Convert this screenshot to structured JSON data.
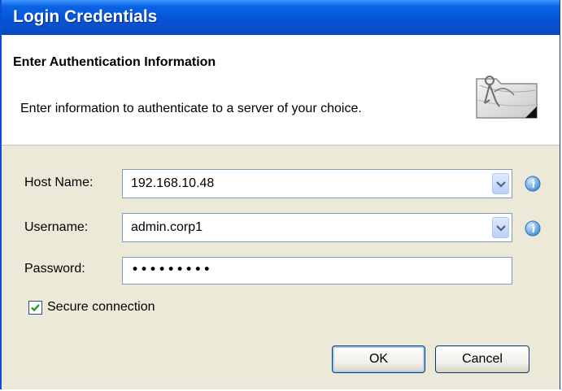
{
  "window": {
    "title": "Login Credentials"
  },
  "banner": {
    "heading": "Enter Authentication Information",
    "description": "Enter information to authenticate to a server of your choice.",
    "icon": "credentials-wizard-icon"
  },
  "form": {
    "host": {
      "label": "Host Name:",
      "value": "192.168.10.48",
      "icon": "info-icon"
    },
    "username": {
      "label": "Username:",
      "value": "admin.corp1",
      "icon": "info-icon"
    },
    "password": {
      "label": "Password:",
      "masked_value": "•••••••••"
    },
    "secure": {
      "label": "Secure connection",
      "checked": true
    }
  },
  "buttons": {
    "ok": "OK",
    "cancel": "Cancel"
  },
  "colors": {
    "titlebar": "#0654d8",
    "window_bg": "#ece9d8",
    "field_border": "#7f9db9",
    "info_icon": "#3b8ad8"
  }
}
